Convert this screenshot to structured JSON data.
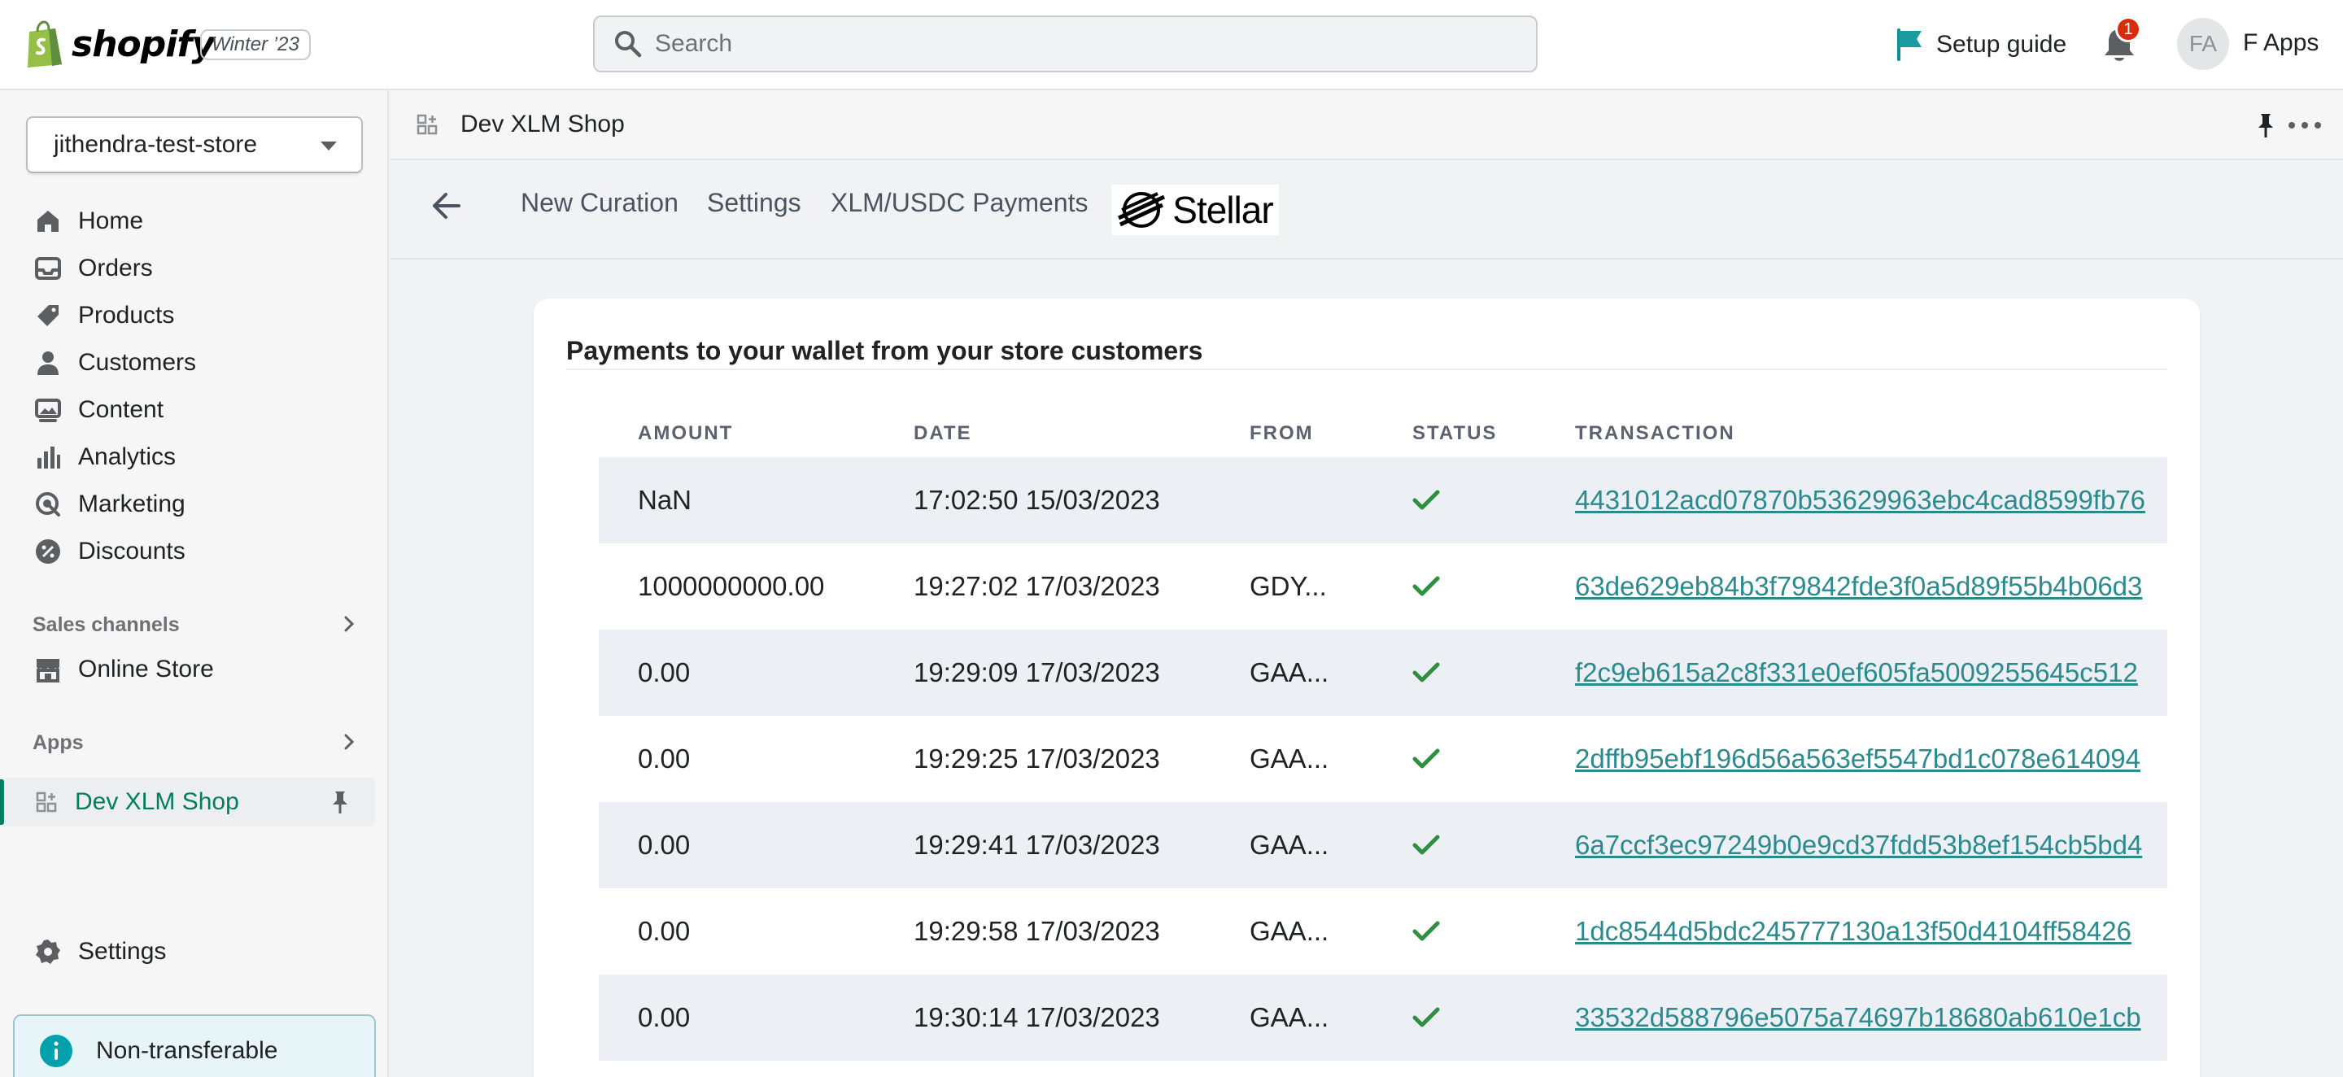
{
  "topbar": {
    "brand": "shopify",
    "edition": "Winter ’23",
    "search_placeholder": "Search",
    "setup_guide": "Setup guide",
    "notifications_count": "1",
    "avatar_initials": "FA",
    "user_name": "F Apps"
  },
  "sidebar": {
    "store_name": "jithendra-test-store",
    "items": [
      {
        "label": "Home",
        "icon": "home-icon"
      },
      {
        "label": "Orders",
        "icon": "orders-icon"
      },
      {
        "label": "Products",
        "icon": "tag-icon"
      },
      {
        "label": "Customers",
        "icon": "person-icon"
      },
      {
        "label": "Content",
        "icon": "image-icon"
      },
      {
        "label": "Analytics",
        "icon": "bar-chart-icon"
      },
      {
        "label": "Marketing",
        "icon": "target-icon"
      },
      {
        "label": "Discounts",
        "icon": "discount-icon"
      }
    ],
    "sales_channels_label": "Sales channels",
    "online_store_label": "Online Store",
    "apps_label": "Apps",
    "app_label": "Dev XLM Shop",
    "settings_label": "Settings",
    "notice": "Non-transferable"
  },
  "app_header": {
    "title": "Dev XLM Shop"
  },
  "tabs": {
    "items": [
      "New Curation",
      "Settings",
      "XLM/USDC Payments"
    ],
    "stellar_label": "Stellar"
  },
  "card": {
    "title": "Payments to your wallet from your store customers",
    "columns": [
      "AMOUNT",
      "DATE",
      "FROM",
      "STATUS",
      "TRANSACTION"
    ],
    "rows": [
      {
        "amount": "NaN",
        "date": "17:02:50 15/03/2023",
        "from": "",
        "status": "success",
        "transaction": "4431012acd07870b53629963ebc4cad8599fb76"
      },
      {
        "amount": "1000000000.00",
        "date": "19:27:02 17/03/2023",
        "from": "GDY...",
        "status": "success",
        "transaction": "63de629eb84b3f79842fde3f0a5d89f55b4b06d3"
      },
      {
        "amount": "0.00",
        "date": "19:29:09 17/03/2023",
        "from": "GAA...",
        "status": "success",
        "transaction": "f2c9eb615a2c8f331e0ef605fa5009255645c512"
      },
      {
        "amount": "0.00",
        "date": "19:29:25 17/03/2023",
        "from": "GAA...",
        "status": "success",
        "transaction": "2dffb95ebf196d56a563ef5547bd1c078e614094"
      },
      {
        "amount": "0.00",
        "date": "19:29:41 17/03/2023",
        "from": "GAA...",
        "status": "success",
        "transaction": "6a7ccf3ec97249b0e9cd37fdd53b8ef154cb5bd4"
      },
      {
        "amount": "0.00",
        "date": "19:29:58 17/03/2023",
        "from": "GAA...",
        "status": "success",
        "transaction": "1dc8544d5bdc245777130a13f50d4104ff58426"
      },
      {
        "amount": "0.00",
        "date": "19:30:14 17/03/2023",
        "from": "GAA...",
        "status": "success",
        "transaction": "33532d588796e5075a74697b18680ab610e1cb"
      }
    ]
  },
  "colors": {
    "accent_green": "#008060",
    "link_teal": "#2b8a8e",
    "check_green": "#2e8f3e",
    "badge_red": "#d72c0d"
  }
}
